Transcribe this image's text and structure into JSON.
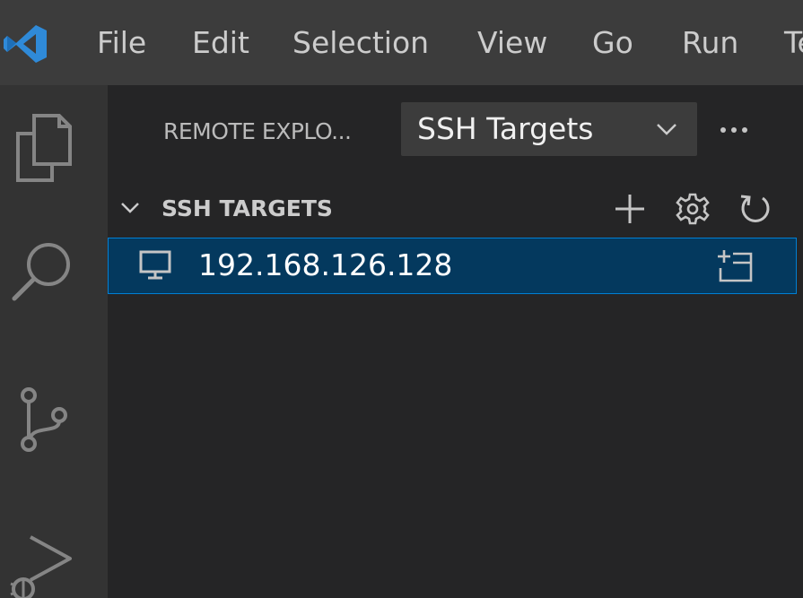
{
  "colors": {
    "menubar_bg": "#3c3c3c",
    "activitybar_bg": "#333333",
    "sidebar_bg": "#252526",
    "selection_bg": "#04395e",
    "selection_border": "#007fd4",
    "logo_blue": "#2f8ad8",
    "icon_color": "#c5c5c5"
  },
  "menubar": {
    "items": [
      {
        "label": "File"
      },
      {
        "label": "Edit"
      },
      {
        "label": "Selection"
      },
      {
        "label": "View"
      },
      {
        "label": "Go"
      },
      {
        "label": "Run"
      },
      {
        "label": "Te"
      }
    ]
  },
  "activitybar": {
    "icons": [
      "explorer-icon",
      "search-icon",
      "source-control-icon",
      "run-debug-icon"
    ]
  },
  "sidebar": {
    "title": "REMOTE EXPLO...",
    "target_select": {
      "selected": "SSH Targets"
    },
    "section": {
      "title": "SSH TARGETS",
      "actions": [
        "add-icon",
        "gear-icon",
        "refresh-icon"
      ]
    },
    "hosts": [
      {
        "label": "192.168.126.128",
        "icon": "monitor-icon",
        "action": "open-new-window-icon"
      }
    ]
  }
}
